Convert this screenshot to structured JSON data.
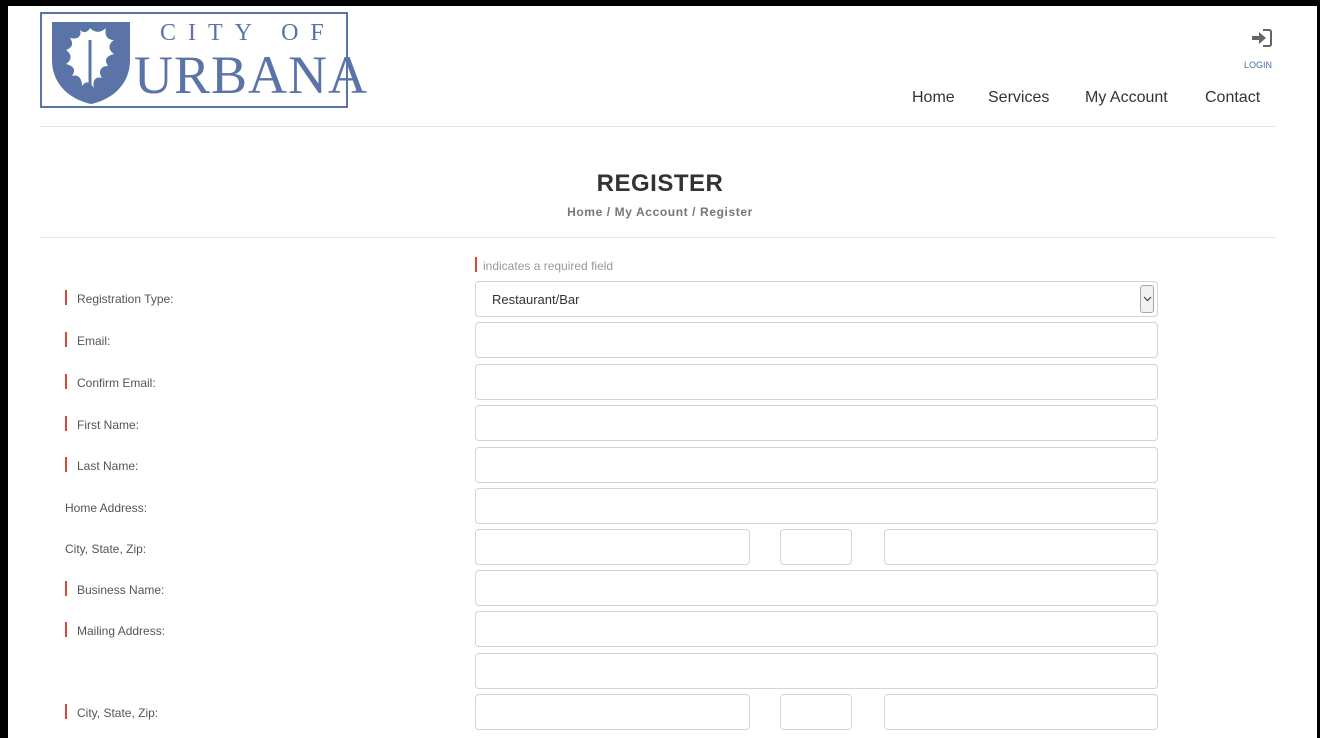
{
  "logo": {
    "line1": "CITY OF",
    "line2": "URBANA"
  },
  "login": {
    "icon": "sign-in-icon",
    "label": "LOGIN"
  },
  "nav": {
    "items": [
      "Home",
      "Services",
      "My Account",
      "Contact"
    ]
  },
  "page": {
    "title": "REGISTER",
    "breadcrumb": {
      "home": "Home",
      "sep": " / ",
      "account": "My Account",
      "current": "Register"
    }
  },
  "form": {
    "required_note": "indicates a required field",
    "registration_type_label": "Registration Type:",
    "registration_type_value": "Restaurant/Bar",
    "email_label": "Email:",
    "confirm_email_label": "Confirm Email:",
    "first_name_label": "First Name:",
    "last_name_label": "Last Name:",
    "home_address_label": "Home Address:",
    "home_csz_label": "City, State, Zip:",
    "business_name_label": "Business Name:",
    "mailing_address_label": "Mailing Address:",
    "mailing_csz_label": "City, State, Zip:"
  },
  "colors": {
    "brand": "#5a74a8",
    "required": "#e0453a",
    "link": "#4a6fa5"
  }
}
